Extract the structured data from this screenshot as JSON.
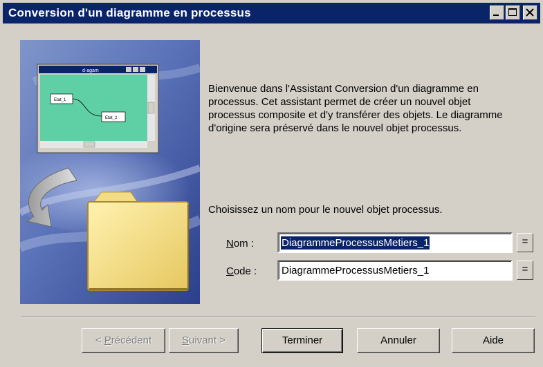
{
  "window": {
    "title": "Conversion d'un diagramme en processus",
    "controls": [
      "minimize-icon",
      "maximize-icon",
      "close-icon"
    ]
  },
  "illustration": {
    "mini_window_title": "d-agam",
    "node_1": "Etat_1",
    "node_2": "Etat_2"
  },
  "intro_text": "Bienvenue dans l'Assistant Conversion d'un diagramme en processus. Cet assistant permet de créer un nouvel objet processus composite et d'y transférer des objets. Le diagramme d'origine sera préservé dans le nouvel objet processus.",
  "choose_text": "Choisissez un nom pour le nouvel objet processus.",
  "fields": {
    "nom": {
      "label_mnemonic": "N",
      "label_rest": "om :",
      "value": "DiagrammeProcessusMetiers_1",
      "button": "="
    },
    "code": {
      "label_mnemonic": "C",
      "label_rest": "ode :",
      "value": "DiagrammeProcessusMetiers_1",
      "button": "="
    }
  },
  "buttons": {
    "back_prefix": "< ",
    "back_mnemonic": "P",
    "back_rest": "récédent",
    "next_mnemonic": "S",
    "next_rest": "uivant >",
    "finish": "Terminer",
    "cancel": "Annuler",
    "help": "Aide"
  },
  "colors": {
    "title_bar": "#0a246a",
    "dialog_bg": "#d4d0c8",
    "selection": "#0a246a"
  }
}
